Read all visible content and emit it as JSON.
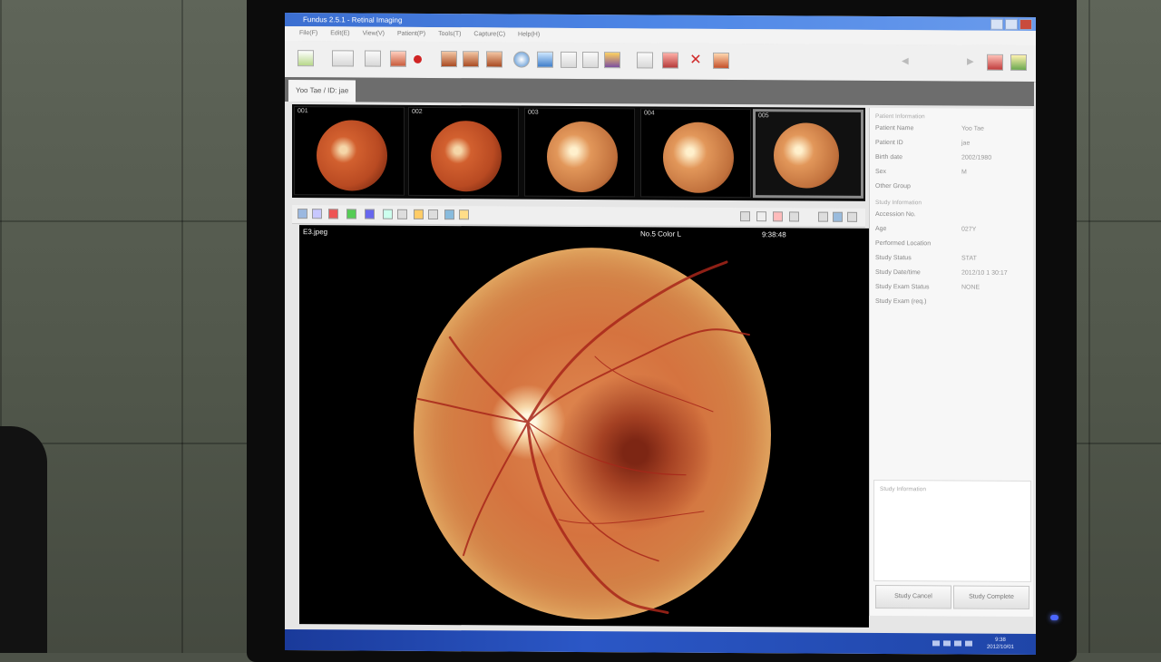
{
  "window": {
    "title": "Fundus 2.5.1 - Retinal Imaging"
  },
  "menu": [
    "File(F)",
    "Edit(E)",
    "View(V)",
    "Patient(P)",
    "Tools(T)",
    "Capture(C)",
    "Help(H)"
  ],
  "tab": {
    "label": "Yoo Tae / ID: jae"
  },
  "thumbnails": [
    {
      "num": "001"
    },
    {
      "num": "002"
    },
    {
      "num": "003"
    },
    {
      "num": "004"
    },
    {
      "num": "005"
    }
  ],
  "viewer": {
    "top_left": "E3.jpeg",
    "top_center": "No.5 Color L",
    "top_right": "9:38:48"
  },
  "side_panel": {
    "patient_section": "Patient Information",
    "patient_rows": [
      {
        "key": "Patient Name",
        "value": "Yoo Tae"
      },
      {
        "key": "Patient ID",
        "value": "jae"
      },
      {
        "key": "Birth date",
        "value": "2002/1980"
      },
      {
        "key": "Sex",
        "value": "M"
      },
      {
        "key": "Other Group",
        "value": ""
      }
    ],
    "study_section": "Study Information",
    "study_rows": [
      {
        "key": "Accession No.",
        "value": ""
      },
      {
        "key": "Age",
        "value": "027Y"
      },
      {
        "key": "Performed Location",
        "value": ""
      },
      {
        "key": "Study Status",
        "value": "STAT"
      },
      {
        "key": "Study Date/time",
        "value": "2012/10 1 30:17"
      },
      {
        "key": "Study Exam Status",
        "value": "NONE"
      },
      {
        "key": "Study Exam (req.)",
        "value": ""
      }
    ],
    "notes_section": "Study Information",
    "cancel_btn": "Study Cancel",
    "complete_btn": "Study Complete"
  },
  "taskbar": {
    "time": "9:38",
    "date": "2012/10/01"
  }
}
